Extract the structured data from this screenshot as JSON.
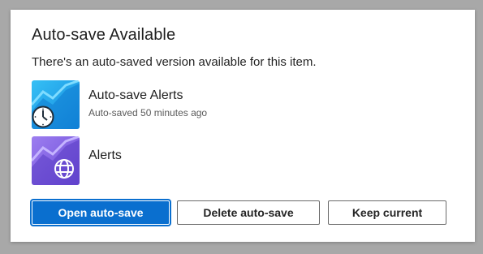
{
  "dialog": {
    "title": "Auto-save Available",
    "message": "There's an auto-saved version available for this item."
  },
  "items": [
    {
      "name": "Auto-save Alerts",
      "subtitle": "Auto-saved 50 minutes ago",
      "icon": "clock-icon",
      "thumb_color": "#1a9be6"
    },
    {
      "name": "Alerts",
      "icon": "globe-icon",
      "thumb_color": "#7b5fe0"
    }
  ],
  "buttons": {
    "open": "Open auto-save",
    "delete": "Delete auto-save",
    "keep": "Keep current"
  },
  "colors": {
    "primary": "#0a6fcf",
    "overlay": "#a8a8a8"
  }
}
